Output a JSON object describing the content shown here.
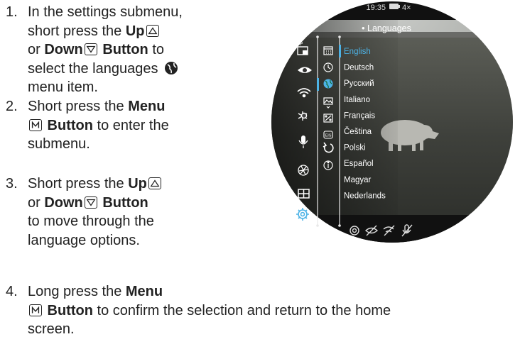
{
  "instructions": [
    {
      "num": "1.",
      "lines": [
        [
          "In the settings submenu,"
        ],
        [
          "short press the ",
          {
            "b": "Up"
          },
          {
            "key": "up"
          }
        ],
        [
          "or ",
          {
            "b": "Down"
          },
          {
            "key": "down"
          },
          {
            "b": " Button"
          },
          " to"
        ],
        [
          "select the languages ",
          {
            "icon": "globe"
          }
        ],
        [
          "menu item."
        ]
      ]
    },
    {
      "num": "2.",
      "lines": [
        [
          "Short press the ",
          {
            "b": "Menu"
          }
        ],
        [
          {
            "key": "M"
          },
          {
            "b": " Button"
          },
          " to enter the"
        ],
        [
          "submenu."
        ]
      ]
    },
    {
      "num": "3.",
      "lines": [
        [
          "Short press the ",
          {
            "b": "Up"
          },
          {
            "key": "up"
          }
        ],
        [
          "or ",
          {
            "b": "Down"
          },
          {
            "key": "down"
          },
          {
            "b": " Button"
          }
        ],
        [
          "to move through the"
        ],
        [
          "language options."
        ]
      ]
    },
    {
      "num": "4.",
      "lines": [
        [
          "Long press the ",
          {
            "b": "Menu"
          }
        ],
        [
          {
            "key": "M"
          },
          {
            "b": " Button"
          },
          " to confirm the selection and return to the home"
        ],
        [
          "screen."
        ]
      ]
    }
  ],
  "device": {
    "status": {
      "time": "19:35",
      "zoom": "4×"
    },
    "menu_title": "• Languages",
    "languages": [
      "English",
      "Deutsch",
      "Русский",
      "Italiano",
      "Français",
      "Čeština",
      "Polski",
      "Español",
      "Magyar",
      "Nederlands"
    ],
    "selected_language": "English",
    "pip_label": "PIP",
    "main_menu_icons": [
      "pip-icon",
      "eye-icon",
      "wifi-icon",
      "brightness-icon",
      "microphone-icon",
      "aperture-icon",
      "grid-icon",
      "settings-gear-icon"
    ],
    "settings_icons": [
      "calendar-icon",
      "clock-icon",
      "globe-icon",
      "image-icon",
      "percent-image-icon",
      "eis-icon",
      "reset-icon",
      "info-icon"
    ],
    "eis_label": "EIS",
    "bottom_status_icons": [
      "aperture-status-icon",
      "eye-off-status-icon",
      "wifi-off-status-icon",
      "mic-off-status-icon"
    ],
    "colors": {
      "accent": "#4db3e6",
      "menu_text": "#ffffff"
    }
  }
}
